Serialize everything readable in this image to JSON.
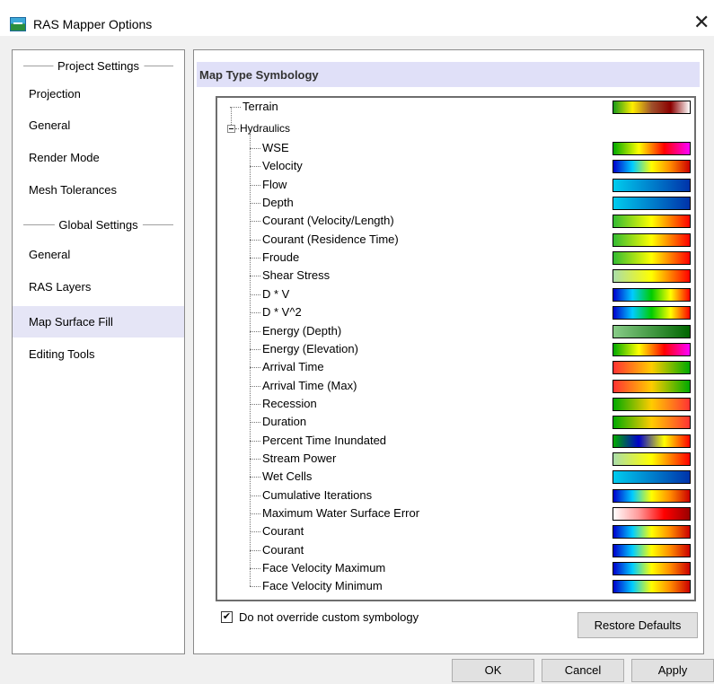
{
  "window": {
    "title": "RAS Mapper Options",
    "close_glyph": "✕",
    "icon": "ras-mapper-app-icon"
  },
  "sidebar": {
    "groups": [
      {
        "title": "Project Settings",
        "items": [
          "Projection",
          "General",
          "Render Mode",
          "Mesh Tolerances"
        ]
      },
      {
        "title": "Global Settings",
        "items": [
          "General",
          "RAS Layers",
          "Map Surface Fill",
          "Editing Tools"
        ]
      }
    ],
    "selected": "Map Surface Fill"
  },
  "main": {
    "section_title": "Map Type Symbology",
    "tree": {
      "terrain": {
        "label": "Terrain",
        "colors": [
          "#1a9b1a",
          "#ffee00",
          "#a0522d",
          "#8b0000",
          "#ffffff"
        ]
      },
      "hydraulics": {
        "label": "Hydraulics",
        "items": [
          {
            "label": "WSE",
            "colors": [
              "#00aa00",
              "#ffff00",
              "#ff0000",
              "#ff00ff"
            ]
          },
          {
            "label": "Velocity",
            "colors": [
              "#0000cc",
              "#00ccff",
              "#ffff00",
              "#ff8800",
              "#cc0000"
            ]
          },
          {
            "label": "Flow",
            "colors": [
              "#00ccee",
              "#0033aa"
            ]
          },
          {
            "label": "Depth",
            "colors": [
              "#00ccee",
              "#0033aa"
            ]
          },
          {
            "label": "Courant (Velocity/Length)",
            "colors": [
              "#33bb33",
              "#ffff00",
              "#ff0000"
            ]
          },
          {
            "label": "Courant (Residence Time)",
            "colors": [
              "#33bb33",
              "#ffff00",
              "#ff0000"
            ]
          },
          {
            "label": "Froude",
            "colors": [
              "#33bb33",
              "#ffff00",
              "#ff0000"
            ]
          },
          {
            "label": "Shear Stress",
            "colors": [
              "#aaddaa",
              "#ffff00",
              "#ff0000"
            ]
          },
          {
            "label": "D * V",
            "colors": [
              "#0000cc",
              "#00ccff",
              "#00cc00",
              "#ffff00",
              "#ff0000"
            ]
          },
          {
            "label": "D * V^2",
            "colors": [
              "#0000cc",
              "#00ccff",
              "#00cc00",
              "#ffff00",
              "#ff0000"
            ]
          },
          {
            "label": "Energy (Depth)",
            "colors": [
              "#88cc88",
              "#006600"
            ]
          },
          {
            "label": "Energy (Elevation)",
            "colors": [
              "#00aa00",
              "#ffff00",
              "#ff0000",
              "#ff00ff"
            ]
          },
          {
            "label": "Arrival Time",
            "colors": [
              "#ff3333",
              "#ffcc00",
              "#00aa00"
            ]
          },
          {
            "label": "Arrival Time (Max)",
            "colors": [
              "#ff3333",
              "#ffcc00",
              "#00aa00"
            ]
          },
          {
            "label": "Recession",
            "colors": [
              "#00aa00",
              "#ffcc00",
              "#ff3333"
            ]
          },
          {
            "label": "Duration",
            "colors": [
              "#00aa00",
              "#ffcc00",
              "#ff3333"
            ]
          },
          {
            "label": "Percent Time Inundated",
            "colors": [
              "#00aa00",
              "#0000cc",
              "#ffff00",
              "#ff0000"
            ]
          },
          {
            "label": "Stream Power",
            "colors": [
              "#aaddaa",
              "#ffff00",
              "#ff0000"
            ]
          },
          {
            "label": "Wet Cells",
            "colors": [
              "#00ccee",
              "#0033aa"
            ]
          },
          {
            "label": "Cumulative Iterations",
            "colors": [
              "#0000cc",
              "#00ccff",
              "#ffff00",
              "#ff8800",
              "#cc0000"
            ]
          },
          {
            "label": "Maximum Water Surface Error",
            "colors": [
              "#ffffff",
              "#ff9999",
              "#ff0000",
              "#990000"
            ]
          },
          {
            "label": "Courant",
            "colors": [
              "#0000cc",
              "#00ccff",
              "#ffff00",
              "#ff8800",
              "#cc0000"
            ]
          },
          {
            "label": "Courant",
            "colors": [
              "#0000cc",
              "#00ccff",
              "#ffff00",
              "#ff8800",
              "#cc0000"
            ]
          },
          {
            "label": "Face Velocity Maximum",
            "colors": [
              "#0000cc",
              "#00ccff",
              "#ffff00",
              "#ff8800",
              "#cc0000"
            ]
          },
          {
            "label": "Face Velocity Minimum",
            "colors": [
              "#0000cc",
              "#00ccff",
              "#ffff00",
              "#ff8800",
              "#cc0000"
            ]
          }
        ]
      }
    },
    "override_checkbox": {
      "label": "Do not override custom symbology",
      "checked": true,
      "check_glyph": "✔"
    },
    "restore_defaults_label": "Restore Defaults"
  },
  "footer": {
    "ok_label": "OK",
    "cancel_label": "Cancel",
    "apply_label": "Apply"
  }
}
